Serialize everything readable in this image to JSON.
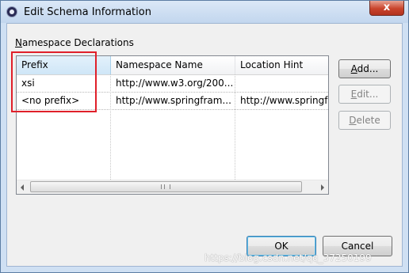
{
  "window": {
    "title": "Edit Schema Information",
    "close_glyph": "x"
  },
  "group": {
    "label_underlined": "N",
    "label_rest": "amespace Declarations"
  },
  "table": {
    "columns": [
      "Prefix",
      "Namespace Name",
      "Location Hint"
    ],
    "rows": [
      {
        "prefix": "xsi",
        "namespace": "http://www.w3.org/200...",
        "location": ""
      },
      {
        "prefix": "<no prefix>",
        "namespace": "http://www.springfram...",
        "location": "http://www.springfr"
      }
    ],
    "scrollbar_grip": "III"
  },
  "buttons": {
    "add": {
      "underlined": "A",
      "rest": "dd..."
    },
    "edit": {
      "underlined": "E",
      "rest": "dit..."
    },
    "delete": {
      "underlined": "D",
      "rest": "elete"
    },
    "ok": "OK",
    "cancel": "Cancel"
  },
  "watermark": "https://blog.csdn.net/qq_37250199",
  "colors": {
    "annotation": "#e0202a",
    "selected_header": "#cfe6f7",
    "titlebar": "#c2d6ee"
  },
  "icons": {
    "app": "eclipse-icon",
    "close": "close-icon",
    "scroll_left": "arrow-left-icon",
    "scroll_right": "arrow-right-icon"
  }
}
